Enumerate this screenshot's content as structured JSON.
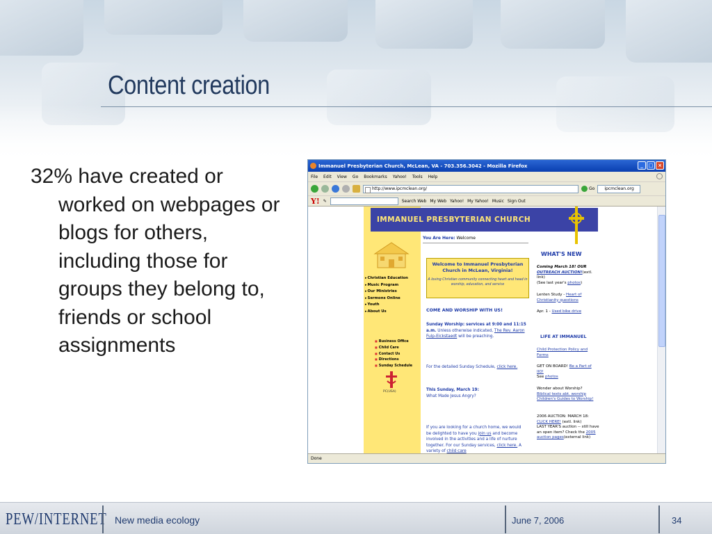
{
  "slide": {
    "title": "Content creation",
    "bullet": "32% have created or worked on webpages or blogs for others, including those for groups they belong to, friends or school assignments"
  },
  "footer": {
    "logo_text": "PEW/INTERNET",
    "section": "New media ecology",
    "date": "June 7, 2006",
    "page": "34"
  },
  "browser": {
    "window_title": "Immanuel Presbyterian Church, McLean, VA - 703.356.3042 - Mozilla Firefox",
    "menu": [
      "File",
      "Edit",
      "View",
      "Go",
      "Bookmarks",
      "Yahoo!",
      "Tools",
      "Help"
    ],
    "url": "http://www.ipcmclean.org/",
    "go_label": "Go",
    "search_value": "ipcmclean.org",
    "yahoo_bar": {
      "logo": "Y!",
      "search_web": "Search Web",
      "items": [
        "My Web",
        "Yahoo!",
        "My Yahoo!",
        "Music",
        "Sign Out"
      ]
    },
    "status": "Done"
  },
  "church": {
    "header": "IMMANUEL PRESBYTERIAN CHURCH",
    "you_are_here_label": "You Are Here:",
    "you_are_here_value": "Welcome",
    "nav": [
      "Christian Education",
      "Music Program",
      "Our Ministries",
      "Sermons Online",
      "Youth",
      "About Us"
    ],
    "subnav": [
      "Business Office",
      "Child Care",
      "Contact Us",
      "Directions",
      "Sunday Schedule"
    ],
    "seal_label": "PC(USA)",
    "welcome_title": "Welcome to Immanuel Presbyterian Church in McLean, Virginia!",
    "welcome_sub": "A loving Christian community connecting heart and head in worship, education, and service",
    "come_worship": "COME AND WORSHIP WITH US!",
    "sunday_worship_bold": "Sunday Worship: services at 9:00 and 11:15 a.m.",
    "sunday_worship_rest": " Unless otherwise indicated, ",
    "preacher_link": "The Rev. Aaron Fulp-Eickstaedt",
    "preaching": " will be preaching.",
    "schedule_text": "For the detailed Sunday Schedule, ",
    "schedule_link": "click here.",
    "this_sunday": "This Sunday, March 19:",
    "sermon": "What Made Jesus Angry?",
    "looking_1": "If you are looking for a church home, we would be delighted to have you ",
    "looking_link1": "join us",
    "looking_2": " and become involved in the activities and a life of nurture together. For our Sunday services, ",
    "looking_link2": "click here.",
    "looking_3": " A variety of ",
    "looking_link3": "child care",
    "whats_new": "WHAT'S NEW",
    "coming": "Coming March 18! OUR",
    "auction_link": "OUTREACH AUCTION!",
    "auction_rest": "(extl. link)",
    "last_year": "(See last year's ",
    "photos_link": "photos",
    "lenten": "Lenten Study - ",
    "lenten_link": "Heart of Christianity questions",
    "apr": "Apr. 1 - ",
    "bike_link": "Used bike drive",
    "life_at": "LIFE AT IMMANUEL",
    "child_policy": "Child Protection Policy and Forms",
    "get_on_board": "GET ON BOARD! ",
    "be_part": "Be a Part of IIO!",
    "see": "See ",
    "photos2": "photos",
    "wonder": "Wonder about Worship?",
    "biblical": "Biblical texts abt. worship",
    "childrens": "Children's Guides to Worship!",
    "auction2006": "2006 AUCTION: MARCH 18:",
    "click_here": "CLICK HERE!",
    "extl": " (extl. link)",
    "last_years_auction": "LAST YEAR'S auction -- still have an open item? Check the ",
    "auction_pages": "2005 auction pages",
    "external": "(external link)"
  }
}
